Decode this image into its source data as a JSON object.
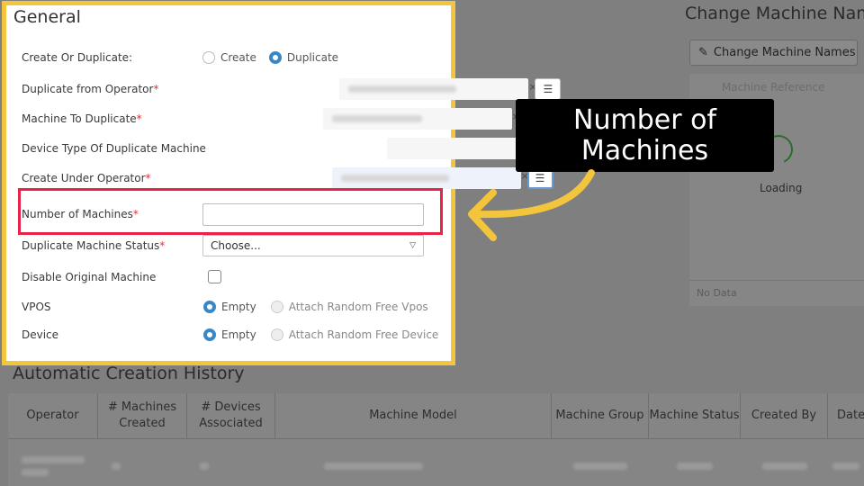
{
  "background": {
    "right_title": "Change Machine Nam",
    "change_names_button": "Change Machine Names",
    "machine_reference_header": "Machine Reference",
    "loading_text": "Loading",
    "no_data_text": "No Data",
    "history": {
      "title": "Automatic Creation History",
      "columns": [
        "Operator",
        "# Machines Created",
        "# Devices Associated",
        "Machine Model",
        "Machine Group",
        "Machine Status",
        "Created By",
        "Date"
      ]
    }
  },
  "general": {
    "title": "General",
    "rows": {
      "create_or_duplicate": {
        "label": "Create Or Duplicate:",
        "options": [
          {
            "label": "Create",
            "selected": false
          },
          {
            "label": "Duplicate",
            "selected": true
          }
        ]
      },
      "duplicate_from_operator": {
        "label": "Duplicate from Operator",
        "required": "*"
      },
      "machine_to_duplicate": {
        "label": "Machine To Duplicate",
        "required": "*"
      },
      "device_type": {
        "label": "Device Type Of Duplicate Machine"
      },
      "create_under_operator": {
        "label": "Create Under Operator",
        "required": "*"
      },
      "number_of_machines": {
        "label": "Number of Machines",
        "required": "*",
        "value": ""
      },
      "duplicate_machine_status": {
        "label": "Duplicate Machine Status",
        "required": "*",
        "value": "Choose..."
      },
      "disable_original_machine": {
        "label": "Disable Original Machine",
        "checked": false
      },
      "vpos": {
        "label": "VPOS",
        "options": [
          {
            "label": "Empty",
            "selected": true
          },
          {
            "label": "Attach Random Free Vpos",
            "selected": false
          }
        ]
      },
      "device": {
        "label": "Device",
        "options": [
          {
            "label": "Empty",
            "selected": true
          },
          {
            "label": "Attach Random Free Device",
            "selected": false
          }
        ]
      }
    },
    "lookup_clear": "×",
    "lookup_list_icon": "list-icon",
    "dropdown_caret": "▽"
  },
  "callout": {
    "text_line1": "Number of",
    "text_line2": "Machines"
  },
  "colors": {
    "highlight_border": "#e8234a",
    "panel_border": "#f2c53d",
    "arrow": "#f2c53d",
    "radio_selected": "#3a87c8"
  }
}
